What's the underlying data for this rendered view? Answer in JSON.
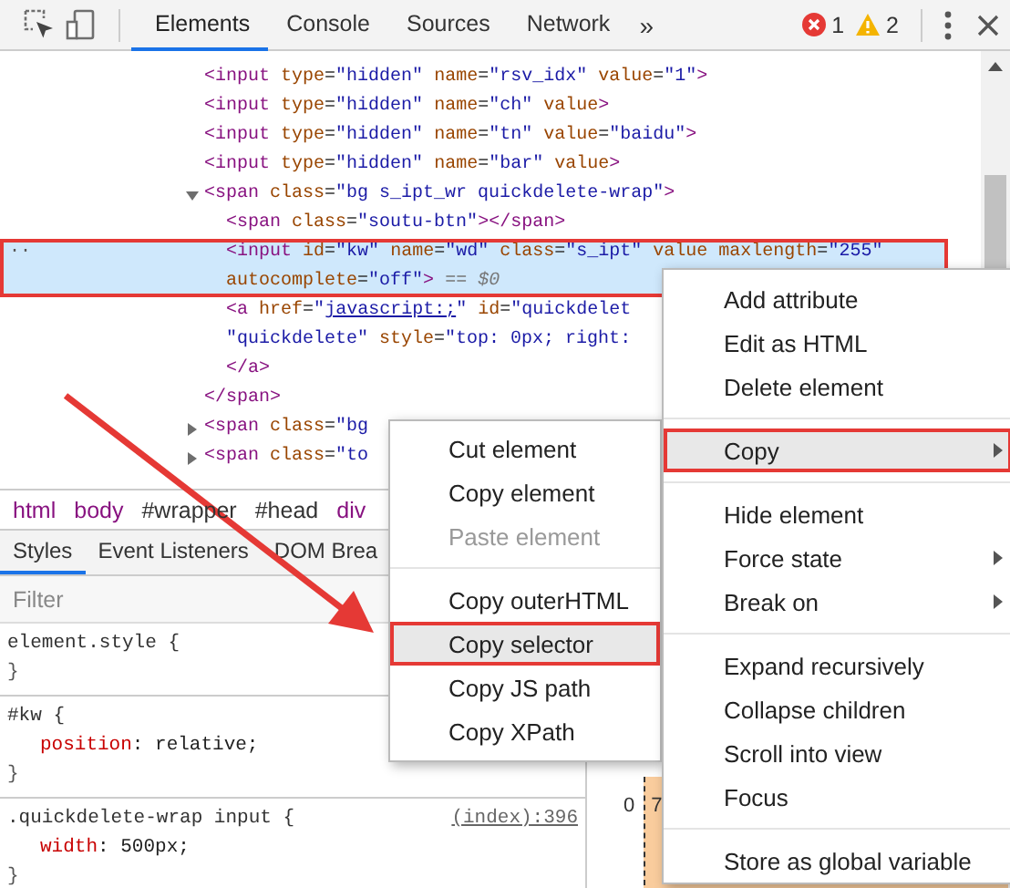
{
  "toolbar": {
    "tabs": [
      {
        "label": "Elements",
        "selected": true
      },
      {
        "label": "Console",
        "selected": false
      },
      {
        "label": "Sources",
        "selected": false
      },
      {
        "label": "Network",
        "selected": false
      }
    ],
    "overflow": "»",
    "errors": "1",
    "warnings": "2"
  },
  "dom_tree": {
    "nodes": [
      {
        "selected": false,
        "lines": [
          [
            {
              "kind": "tag",
              "text": "<input"
            },
            {
              "kind": "attr",
              "text": " type"
            },
            {
              "kind": "punct",
              "text": "="
            },
            {
              "kind": "value",
              "text": "\"hidden\""
            },
            {
              "kind": "attr",
              "text": " name"
            },
            {
              "kind": "punct",
              "text": "="
            },
            {
              "kind": "value",
              "text": "\"rsv_idx\""
            },
            {
              "kind": "attr",
              "text": " value"
            },
            {
              "kind": "punct",
              "text": "="
            },
            {
              "kind": "value",
              "text": "\"1\""
            },
            {
              "kind": "tag",
              "text": ">"
            }
          ]
        ]
      },
      {
        "selected": false,
        "lines": [
          [
            {
              "kind": "tag",
              "text": "<input"
            },
            {
              "kind": "attr",
              "text": " type"
            },
            {
              "kind": "punct",
              "text": "="
            },
            {
              "kind": "value",
              "text": "\"hidden\""
            },
            {
              "kind": "attr",
              "text": " name"
            },
            {
              "kind": "punct",
              "text": "="
            },
            {
              "kind": "value",
              "text": "\"ch\""
            },
            {
              "kind": "attr",
              "text": " value"
            },
            {
              "kind": "tag",
              "text": ">"
            }
          ]
        ]
      },
      {
        "selected": false,
        "lines": [
          [
            {
              "kind": "tag",
              "text": "<input"
            },
            {
              "kind": "attr",
              "text": " type"
            },
            {
              "kind": "punct",
              "text": "="
            },
            {
              "kind": "value",
              "text": "\"hidden\""
            },
            {
              "kind": "attr",
              "text": " name"
            },
            {
              "kind": "punct",
              "text": "="
            },
            {
              "kind": "value",
              "text": "\"tn\""
            },
            {
              "kind": "attr",
              "text": " value"
            },
            {
              "kind": "punct",
              "text": "="
            },
            {
              "kind": "value",
              "text": "\"baidu\""
            },
            {
              "kind": "tag",
              "text": ">"
            }
          ]
        ]
      },
      {
        "selected": false,
        "lines": [
          [
            {
              "kind": "tag",
              "text": "<input"
            },
            {
              "kind": "attr",
              "text": " type"
            },
            {
              "kind": "punct",
              "text": "="
            },
            {
              "kind": "value",
              "text": "\"hidden\""
            },
            {
              "kind": "attr",
              "text": " name"
            },
            {
              "kind": "punct",
              "text": "="
            },
            {
              "kind": "value",
              "text": "\"bar\""
            },
            {
              "kind": "attr",
              "text": " value"
            },
            {
              "kind": "tag",
              "text": ">"
            }
          ]
        ]
      },
      {
        "selected": false,
        "expanded": true,
        "lines": [
          [
            {
              "kind": "tag",
              "text": "<span"
            },
            {
              "kind": "attr",
              "text": " class"
            },
            {
              "kind": "punct",
              "text": "="
            },
            {
              "kind": "value",
              "text": "\"bg s_ipt_wr quickdelete-wrap\""
            },
            {
              "kind": "tag",
              "text": ">"
            }
          ]
        ],
        "closing": [
          {
            "kind": "tag",
            "text": "</span>"
          }
        ],
        "children": [
          {
            "selected": false,
            "lines": [
              [
                {
                  "kind": "tag",
                  "text": "<span"
                },
                {
                  "kind": "attr",
                  "text": " class"
                },
                {
                  "kind": "punct",
                  "text": "="
                },
                {
                  "kind": "value",
                  "text": "\"soutu-btn\""
                },
                {
                  "kind": "tag",
                  "text": "></span>"
                }
              ]
            ]
          },
          {
            "selected": true,
            "marker": "··",
            "lines": [
              [
                {
                  "kind": "tag",
                  "text": "<input"
                },
                {
                  "kind": "attr",
                  "text": " id"
                },
                {
                  "kind": "punct",
                  "text": "="
                },
                {
                  "kind": "value",
                  "text": "\"kw\""
                },
                {
                  "kind": "attr",
                  "text": " name"
                },
                {
                  "kind": "punct",
                  "text": "="
                },
                {
                  "kind": "value",
                  "text": "\"wd\""
                },
                {
                  "kind": "attr",
                  "text": " class"
                },
                {
                  "kind": "punct",
                  "text": "="
                },
                {
                  "kind": "value",
                  "text": "\"s_ipt\""
                },
                {
                  "kind": "attr",
                  "text": " value maxlength"
                },
                {
                  "kind": "punct",
                  "text": "="
                },
                {
                  "kind": "value",
                  "text": "\"255\""
                }
              ],
              [
                {
                  "kind": "attr",
                  "text": "autocomplete"
                },
                {
                  "kind": "punct",
                  "text": "="
                },
                {
                  "kind": "value",
                  "text": "\"off\""
                },
                {
                  "kind": "tag",
                  "text": ">"
                },
                {
                  "kind": "note",
                  "text": " == $0"
                }
              ]
            ]
          },
          {
            "selected": false,
            "lines": [
              [
                {
                  "kind": "tag",
                  "text": "<a"
                },
                {
                  "kind": "attr",
                  "text": " href"
                },
                {
                  "kind": "punct",
                  "text": "="
                },
                {
                  "kind": "value",
                  "text": "\""
                },
                {
                  "kind": "link",
                  "text": "javascript:;"
                },
                {
                  "kind": "value",
                  "text": "\""
                },
                {
                  "kind": "attr",
                  "text": " id"
                },
                {
                  "kind": "punct",
                  "text": "="
                },
                {
                  "kind": "value",
                  "text": "\"quickdelet"
                }
              ],
              [
                {
                  "kind": "value",
                  "text": "\"quickdelete\""
                },
                {
                  "kind": "attr",
                  "text": " style"
                },
                {
                  "kind": "punct",
                  "text": "="
                },
                {
                  "kind": "value",
                  "text": "\"top: 0px; right:"
                }
              ]
            ],
            "closing": [
              {
                "kind": "tag",
                "text": "</a>"
              }
            ]
          }
        ]
      },
      {
        "selected": false,
        "expanded": false,
        "lines": [
          [
            {
              "kind": "tag",
              "text": "<span"
            },
            {
              "kind": "attr",
              "text": " class"
            },
            {
              "kind": "punct",
              "text": "="
            },
            {
              "kind": "value",
              "text": "\"bg"
            }
          ]
        ]
      },
      {
        "selected": false,
        "expanded": false,
        "lines": [
          [
            {
              "kind": "tag",
              "text": "<span"
            },
            {
              "kind": "attr",
              "text": " class"
            },
            {
              "kind": "punct",
              "text": "="
            },
            {
              "kind": "value",
              "text": "\"to"
            }
          ]
        ]
      }
    ]
  },
  "breadcrumb": [
    {
      "label": "html",
      "kind": "tag"
    },
    {
      "label": "body",
      "kind": "tag"
    },
    {
      "label": "#wrapper",
      "kind": "id"
    },
    {
      "label": "#head",
      "kind": "id"
    },
    {
      "label": "div",
      "kind": "tag"
    }
  ],
  "sidebar_tabs": [
    {
      "label": "Styles",
      "selected": true
    },
    {
      "label": "Event Listeners",
      "selected": false
    },
    {
      "label": "DOM Brea",
      "selected": false
    }
  ],
  "filter": {
    "placeholder": "Filter"
  },
  "style_rules": [
    {
      "selector": "element.style {",
      "close": "}"
    },
    {
      "selector": "#kw {",
      "declarations": [
        {
          "property": "position",
          "value": ": relative;"
        }
      ],
      "close": "}"
    },
    {
      "selector": ".quickdelete-wrap input {",
      "source": "(index):396",
      "declarations": [
        {
          "property": "width",
          "value": ": 500px;"
        }
      ],
      "close": "}"
    }
  ],
  "box_model": {
    "values": [
      "0",
      "7"
    ]
  },
  "copy_submenu": {
    "groups": [
      [
        {
          "label": "Cut element",
          "highlighted": false,
          "disabled": false
        },
        {
          "label": "Copy element",
          "highlighted": false,
          "disabled": false
        },
        {
          "label": "Paste element",
          "highlighted": false,
          "disabled": true
        }
      ],
      [
        {
          "label": "Copy outerHTML",
          "highlighted": false,
          "disabled": false
        },
        {
          "label": "Copy selector",
          "highlighted": true,
          "disabled": false
        },
        {
          "label": "Copy JS path",
          "highlighted": false,
          "disabled": false
        },
        {
          "label": "Copy XPath",
          "highlighted": false,
          "disabled": false
        }
      ]
    ]
  },
  "context_menu": {
    "groups": [
      [
        {
          "label": "Add attribute",
          "highlighted": false,
          "submenu": false
        },
        {
          "label": "Edit as HTML",
          "highlighted": false,
          "submenu": false
        },
        {
          "label": "Delete element",
          "highlighted": false,
          "submenu": false
        }
      ],
      [
        {
          "label": "Copy",
          "highlighted": true,
          "submenu": true
        }
      ],
      [
        {
          "label": "Hide element",
          "highlighted": false,
          "submenu": false
        },
        {
          "label": "Force state",
          "highlighted": false,
          "submenu": true
        },
        {
          "label": "Break on",
          "highlighted": false,
          "submenu": true
        }
      ],
      [
        {
          "label": "Expand recursively",
          "highlighted": false,
          "submenu": false
        },
        {
          "label": "Collapse children",
          "highlighted": false,
          "submenu": false
        },
        {
          "label": "Scroll into view",
          "highlighted": false,
          "submenu": false
        },
        {
          "label": "Focus",
          "highlighted": false,
          "submenu": false
        }
      ],
      [
        {
          "label": "Store as global variable",
          "highlighted": false,
          "submenu": false
        }
      ]
    ]
  }
}
